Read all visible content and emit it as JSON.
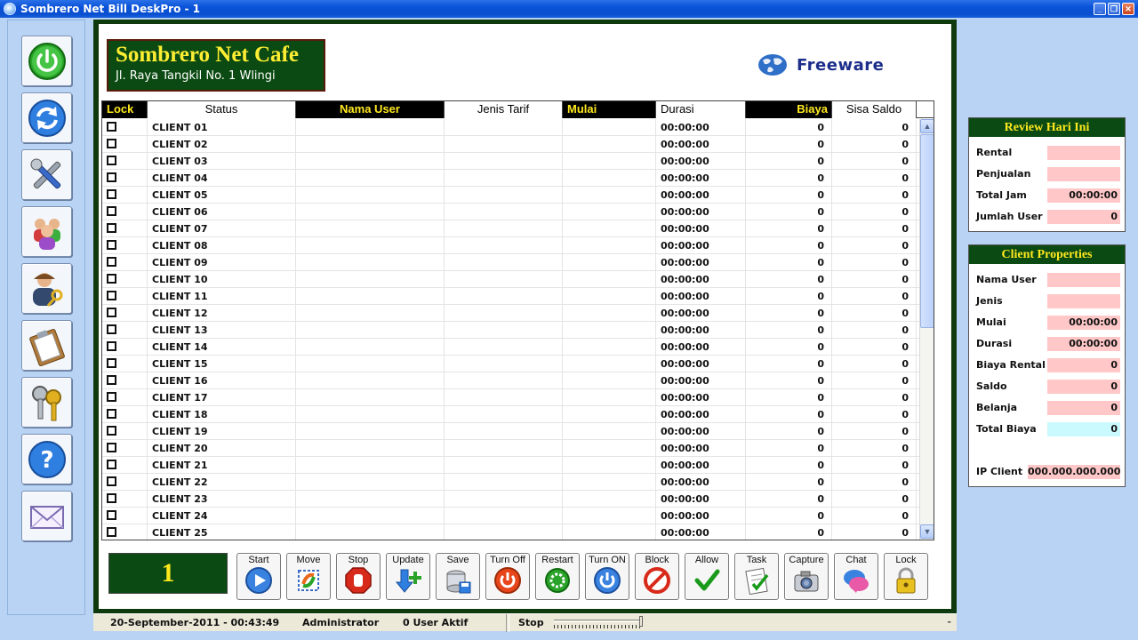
{
  "window": {
    "title": "Sombrero Net Bill DeskPro - 1"
  },
  "left_toolbar": [
    {
      "name": "power",
      "icon": "power-icon"
    },
    {
      "name": "refresh",
      "icon": "refresh-icon"
    },
    {
      "name": "settings",
      "icon": "tools-icon"
    },
    {
      "name": "users",
      "icon": "users-group-icon"
    },
    {
      "name": "admin",
      "icon": "user-key-icon"
    },
    {
      "name": "report",
      "icon": "clipboard-icon"
    },
    {
      "name": "keys",
      "icon": "keys-icon"
    },
    {
      "name": "help",
      "icon": "help-icon"
    },
    {
      "name": "message",
      "icon": "envelope-icon"
    }
  ],
  "header": {
    "cafe_name": "Sombrero Net Cafe",
    "cafe_address": "Jl. Raya Tangkil No. 1 Wlingi",
    "freeware_label": "Freeware"
  },
  "grid": {
    "columns": [
      "Lock",
      "Status",
      "Nama User",
      "Jenis Tarif",
      "Mulai",
      "Durasi",
      "Biaya",
      "Sisa Saldo"
    ],
    "rows": [
      {
        "status": "CLIENT 01",
        "durasi": "00:00:00",
        "biaya": "0",
        "sisa": "0"
      },
      {
        "status": "CLIENT 02",
        "durasi": "00:00:00",
        "biaya": "0",
        "sisa": "0"
      },
      {
        "status": "CLIENT 03",
        "durasi": "00:00:00",
        "biaya": "0",
        "sisa": "0"
      },
      {
        "status": "CLIENT 04",
        "durasi": "00:00:00",
        "biaya": "0",
        "sisa": "0"
      },
      {
        "status": "CLIENT 05",
        "durasi": "00:00:00",
        "biaya": "0",
        "sisa": "0"
      },
      {
        "status": "CLIENT 06",
        "durasi": "00:00:00",
        "biaya": "0",
        "sisa": "0"
      },
      {
        "status": "CLIENT 07",
        "durasi": "00:00:00",
        "biaya": "0",
        "sisa": "0"
      },
      {
        "status": "CLIENT 08",
        "durasi": "00:00:00",
        "biaya": "0",
        "sisa": "0"
      },
      {
        "status": "CLIENT 09",
        "durasi": "00:00:00",
        "biaya": "0",
        "sisa": "0"
      },
      {
        "status": "CLIENT 10",
        "durasi": "00:00:00",
        "biaya": "0",
        "sisa": "0"
      },
      {
        "status": "CLIENT 11",
        "durasi": "00:00:00",
        "biaya": "0",
        "sisa": "0"
      },
      {
        "status": "CLIENT 12",
        "durasi": "00:00:00",
        "biaya": "0",
        "sisa": "0"
      },
      {
        "status": "CLIENT 13",
        "durasi": "00:00:00",
        "biaya": "0",
        "sisa": "0"
      },
      {
        "status": "CLIENT 14",
        "durasi": "00:00:00",
        "biaya": "0",
        "sisa": "0"
      },
      {
        "status": "CLIENT 15",
        "durasi": "00:00:00",
        "biaya": "0",
        "sisa": "0"
      },
      {
        "status": "CLIENT 16",
        "durasi": "00:00:00",
        "biaya": "0",
        "sisa": "0"
      },
      {
        "status": "CLIENT 17",
        "durasi": "00:00:00",
        "biaya": "0",
        "sisa": "0"
      },
      {
        "status": "CLIENT 18",
        "durasi": "00:00:00",
        "biaya": "0",
        "sisa": "0"
      },
      {
        "status": "CLIENT 19",
        "durasi": "00:00:00",
        "biaya": "0",
        "sisa": "0"
      },
      {
        "status": "CLIENT 20",
        "durasi": "00:00:00",
        "biaya": "0",
        "sisa": "0"
      },
      {
        "status": "CLIENT 21",
        "durasi": "00:00:00",
        "biaya": "0",
        "sisa": "0"
      },
      {
        "status": "CLIENT 22",
        "durasi": "00:00:00",
        "biaya": "0",
        "sisa": "0"
      },
      {
        "status": "CLIENT 23",
        "durasi": "00:00:00",
        "biaya": "0",
        "sisa": "0"
      },
      {
        "status": "CLIENT 24",
        "durasi": "00:00:00",
        "biaya": "0",
        "sisa": "0"
      },
      {
        "status": "CLIENT 25",
        "durasi": "00:00:00",
        "biaya": "0",
        "sisa": "0"
      }
    ]
  },
  "counter": "1",
  "actions": [
    {
      "label": "Start",
      "icon": "play-icon"
    },
    {
      "label": "Move",
      "icon": "move-icon"
    },
    {
      "label": "Stop",
      "icon": "stop-hand-icon"
    },
    {
      "label": "Update",
      "icon": "update-arrow-icon"
    },
    {
      "label": "Save",
      "icon": "save-disk-icon"
    },
    {
      "label": "Turn Off",
      "icon": "power-off-icon"
    },
    {
      "label": "Restart",
      "icon": "restart-icon"
    },
    {
      "label": "Turn ON",
      "icon": "power-on-icon"
    },
    {
      "label": "Block",
      "icon": "block-icon"
    },
    {
      "label": "Allow",
      "icon": "check-icon"
    },
    {
      "label": "Task",
      "icon": "task-icon"
    },
    {
      "label": "Capture",
      "icon": "camera-icon"
    },
    {
      "label": "Chat",
      "icon": "chat-icon"
    },
    {
      "label": "Lock",
      "icon": "padlock-icon"
    }
  ],
  "review": {
    "title": "Review Hari Ini",
    "rental_label": "Rental",
    "rental_value": "",
    "penjualan_label": "Penjualan",
    "penjualan_value": "",
    "total_jam_label": "Total Jam",
    "total_jam_value": "00:00:00",
    "jumlah_user_label": "Jumlah User",
    "jumlah_user_value": "0"
  },
  "client_props": {
    "title": "Client Properties",
    "nama_user_label": "Nama User",
    "nama_user_value": "",
    "jenis_label": "Jenis",
    "jenis_value": "",
    "mulai_label": "Mulai",
    "mulai_value": "00:00:00",
    "durasi_label": "Durasi",
    "durasi_value": "00:00:00",
    "biaya_rental_label": "Biaya Rental",
    "biaya_rental_value": "0",
    "saldo_label": "Saldo",
    "saldo_value": "0",
    "belanja_label": "Belanja",
    "belanja_value": "0",
    "total_biaya_label": "Total Biaya",
    "total_biaya_value": "0",
    "ip_label": "IP Client",
    "ip_value": "000.000.000.000"
  },
  "statusbar": {
    "datetime": "20-September-2011  -  00:43:49",
    "user": "Administrator",
    "active_users": "0 User Aktif",
    "state": "Stop"
  },
  "colors": {
    "panel_green": "#0b4a12",
    "header_yellow": "#ffe91e",
    "value_pink": "#ffc7c7",
    "value_cyan": "#cafafe"
  }
}
